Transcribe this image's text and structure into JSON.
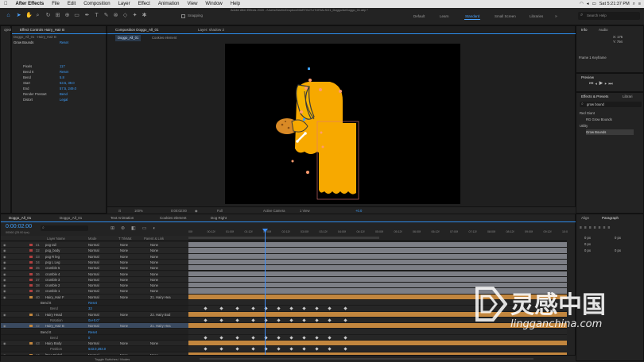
{
  "menubar": {
    "apple": "",
    "items": [
      "After Effects",
      "File",
      "Edit",
      "Composition",
      "Layer",
      "Effect",
      "Animation",
      "View",
      "Window",
      "Help"
    ],
    "clock": "Sat 5:21:37 PM"
  },
  "toolbar": {
    "title": "Adobe After Effects 2020 - /Users/Martin/Dropbox/MARTIN/TUTORIALS/01_Doggo/AeDoggo_01.aep *",
    "snapping": "Snapping",
    "workspaces": [
      "Default",
      "Learn",
      "Standard",
      "Small Screen",
      "Libraries"
    ],
    "active_workspace": "Standard",
    "search_placeholder": "Search Help"
  },
  "project_panel": {
    "tab": "oject"
  },
  "effect_controls": {
    "tab": "Effect Controls Hairy_Hair B",
    "layer_path": "Doggo_All_01 · Hairy_Hair B",
    "effect_name": "Grow Bounds",
    "reset": "Reset",
    "rows": [
      {
        "label": "Pixels",
        "value": "117"
      },
      {
        "label": "Bend It",
        "value": "Reset"
      },
      {
        "label": "Bend",
        "value": "5.8"
      },
      {
        "label": "Start",
        "value": "53.5, 39.0"
      },
      {
        "label": "End",
        "value": "57.5, 249.0"
      },
      {
        "label": "Render Prestart",
        "value": "Bend"
      },
      {
        "label": "Distort",
        "value": "Legal"
      }
    ]
  },
  "composition": {
    "panel_tab": "Composition Doggo_All_01",
    "viewer_tabs": [
      "Doggo_All_01",
      "Cookies element"
    ],
    "layer_tab": "Layer: shadow 2",
    "footer": {
      "zoom": "100%",
      "time": "0:00:02:00",
      "resolution": "Full",
      "camera": "Active Camera",
      "view": "1 View",
      "exposure": "+0.0"
    }
  },
  "right_panels": {
    "info_tab": "Info",
    "audio_tab": "Audio",
    "info_lines": [
      "X: 175",
      "Y: 794",
      "",
      "Frame 1 Keyframe"
    ],
    "preview_tab": "Preview",
    "effects_tab": "Effects & Presets",
    "libraries_tab": "Librari",
    "effects_search": "grow bound",
    "tree": [
      {
        "label": "Red Giant",
        "indent": 0
      },
      {
        "label": "RG Grow Bounds",
        "indent": 1
      },
      {
        "label": "Utility",
        "indent": 0
      },
      {
        "label": "Grow Bounds",
        "indent": 1,
        "selected": true
      }
    ],
    "align_tab": "Align",
    "paragraph_tab": "Paragraph",
    "para_values": [
      "0 px",
      "0 px",
      "0 px",
      "0 px",
      "0 px"
    ]
  },
  "timeline": {
    "tabs": [
      "Doggo_All_01",
      "Doggo_All_01",
      "Text Animation",
      "Cookies element",
      "Dog Right"
    ],
    "timecode": "0:00:02:00",
    "frames": "00060 (25.00 fps)",
    "columns": [
      "Layer Name",
      "Mode",
      "T TrkMat",
      "Parent & Link"
    ],
    "ruler": [
      "00f",
      "00:12f",
      "01:00f",
      "01:12f",
      "02:00f",
      "02:12f",
      "03:00f",
      "03:12f",
      "04:00f",
      "04:12f",
      "05:00f",
      "05:12f",
      "06:00f",
      "06:12f",
      "07:00f",
      "07:12f",
      "08:00f",
      "08:12f",
      "09:00f",
      "09:12f",
      "10:0"
    ],
    "toggle_label": "Toggle Switches / Modes",
    "layers": [
      {
        "num": "31",
        "name": "pog tail",
        "mode": "Normal",
        "trk": "None",
        "parent": "None",
        "kind": "layer",
        "bar": "#7d7f86"
      },
      {
        "num": "32",
        "name": "pog_body",
        "mode": "Normal",
        "trk": "None",
        "parent": "None",
        "kind": "layer",
        "bar": "#7d7f86"
      },
      {
        "num": "33",
        "name": "pog R leg",
        "mode": "Normal",
        "trk": "None",
        "parent": "None",
        "kind": "layer",
        "bar": "#7d7f86"
      },
      {
        "num": "34",
        "name": "pog L Leg",
        "mode": "Normal",
        "trk": "None",
        "parent": "None",
        "kind": "layer",
        "bar": "#7d7f86"
      },
      {
        "num": "35",
        "name": "crumble 5",
        "mode": "Normal",
        "trk": "None",
        "parent": "None",
        "kind": "layer",
        "bar": "#7d7f86"
      },
      {
        "num": "36",
        "name": "crumble 4",
        "mode": "Normal",
        "trk": "None",
        "parent": "None",
        "kind": "layer",
        "bar": "#7d7f86"
      },
      {
        "num": "37",
        "name": "crumble 3",
        "mode": "Normal",
        "trk": "None",
        "parent": "None",
        "kind": "layer",
        "bar": "#7d7f86"
      },
      {
        "num": "38",
        "name": "crumble 2",
        "mode": "Normal",
        "trk": "None",
        "parent": "None",
        "kind": "layer",
        "bar": "#7d7f86"
      },
      {
        "num": "39",
        "name": "crumble 1",
        "mode": "Normal",
        "trk": "None",
        "parent": "None",
        "kind": "layer",
        "bar": "#7d7f86"
      },
      {
        "num": "40",
        "name": "Hairy_Hair F",
        "mode": "Normal",
        "trk": "None",
        "parent": "21. Hairy Hea",
        "kind": "layer",
        "bar": "#c2863e"
      },
      {
        "num": "",
        "name": "Bend It",
        "mode": "Reset",
        "trk": "",
        "parent": "",
        "kind": "sub",
        "bar": ""
      },
      {
        "num": "",
        "name": "Bend",
        "mode": "33",
        "trk": "",
        "parent": "",
        "kind": "prop",
        "bar": "keys"
      },
      {
        "num": "41",
        "name": "Hairy Head",
        "mode": "Normal",
        "trk": "None",
        "parent": "22. Hairy Bod",
        "kind": "layer",
        "bar": "#c2863e"
      },
      {
        "num": "",
        "name": "Rotation",
        "mode": "0x+0.0°",
        "trk": "",
        "parent": "",
        "kind": "prop",
        "bar": "keys"
      },
      {
        "num": "42",
        "name": "Hairy_Hair B",
        "mode": "Normal",
        "trk": "None",
        "parent": "21. Hairy Hea",
        "kind": "layer",
        "bar": "#c2863e",
        "selected": true
      },
      {
        "num": "",
        "name": "Bend It",
        "mode": "Reset",
        "trk": "",
        "parent": "",
        "kind": "sub",
        "bar": ""
      },
      {
        "num": "",
        "name": "Bend",
        "mode": "0",
        "trk": "",
        "parent": "",
        "kind": "prop",
        "bar": "keys"
      },
      {
        "num": "43",
        "name": "Hairy Body",
        "mode": "Normal",
        "trk": "None",
        "parent": "None",
        "kind": "layer",
        "bar": "#c2863e"
      },
      {
        "num": "",
        "name": "Position",
        "mode": "543.0,283.0",
        "trk": "",
        "parent": "",
        "kind": "prop",
        "bar": "keys"
      },
      {
        "num": "44",
        "name": "[Dog Right]",
        "mode": "Normal",
        "trk": "None",
        "parent": "None",
        "kind": "layer",
        "bar": "#c2863e"
      }
    ]
  },
  "watermark": {
    "cn": "灵感中国",
    "url": "lingganchina.com"
  },
  "colors": {
    "accent": "#2d8ceb",
    "dog": "#f7a900",
    "dog_dark": "#3a3a3a",
    "cookie": "#d98a26",
    "playhead": "#3e8ef7"
  }
}
